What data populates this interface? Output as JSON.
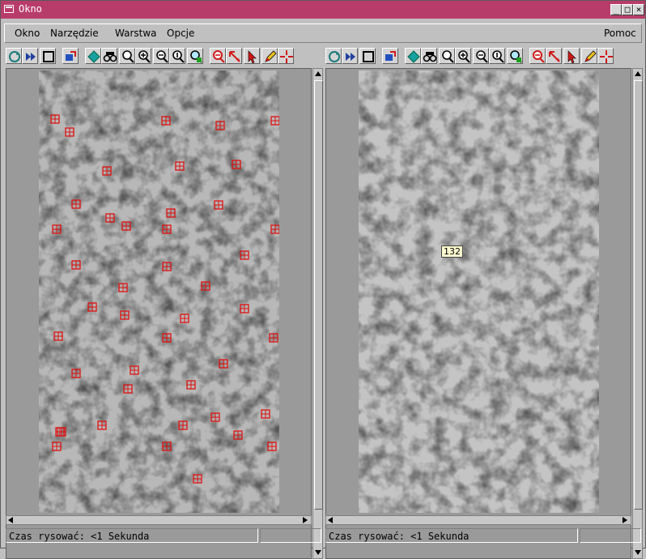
{
  "window": {
    "title": "Okno"
  },
  "menubar": {
    "items": [
      {
        "label": "Okno"
      },
      {
        "label": "Narzędzie"
      },
      {
        "label": "Warstwa"
      },
      {
        "label": "Opcje"
      }
    ],
    "help": "Pomoc"
  },
  "toolbar": {
    "icons": [
      "redraw-icon",
      "skip-icon",
      "frame-icon",
      "layer-manager-icon",
      "diamond-icon",
      "binoculars-icon",
      "zoom-tool-icon",
      "zoom-in-icon",
      "zoom-out-icon",
      "zoom-1-icon",
      "zoom-full-icon",
      "zoom-cancel-icon",
      "select-arrow-icon",
      "pointer-icon",
      "pencil-icon",
      "crosshair-icon"
    ],
    "colors": {
      "button_face": "#d4d4d4",
      "accent_red": "#d01818",
      "accent_teal": "#189898"
    }
  },
  "left_pane": {
    "status": "Czas rysować: <1 Sekunda"
  },
  "right_pane": {
    "status": "Czas rysować: <1 Sekunda",
    "point_label": "132"
  },
  "colors": {
    "titlebar": "#b83c6a",
    "marker": "#e01010"
  }
}
